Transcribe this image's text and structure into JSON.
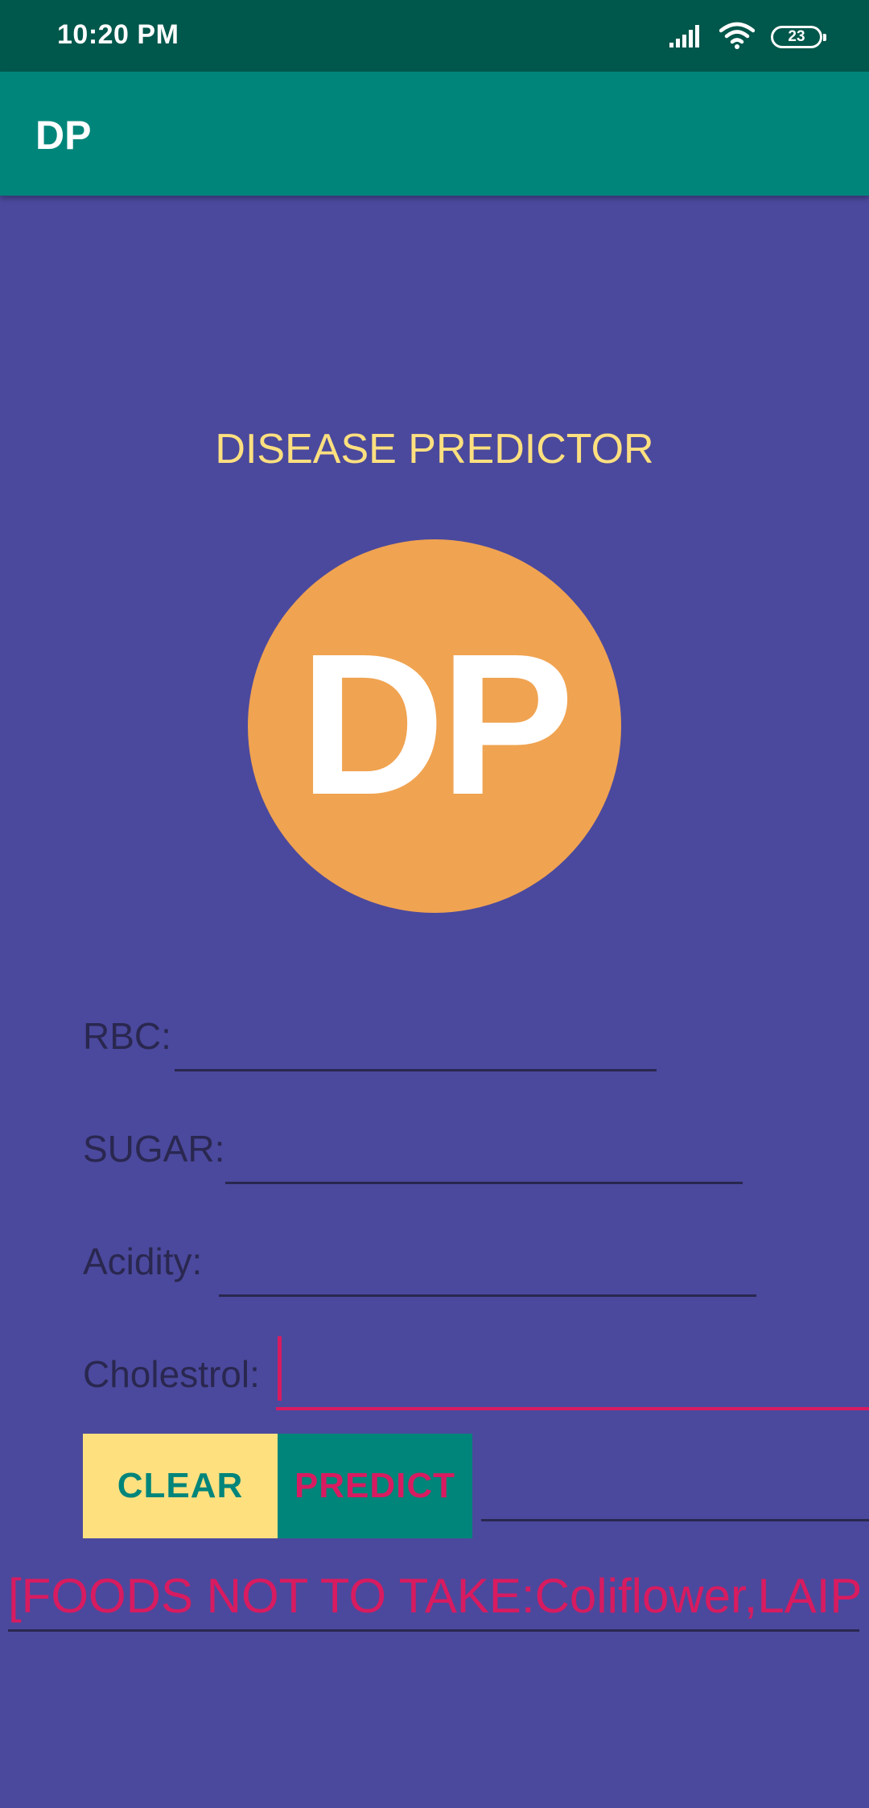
{
  "status_bar": {
    "time": "10:20 PM",
    "battery": "23",
    "icons": [
      "signal-icon",
      "wifi-icon",
      "battery-icon"
    ]
  },
  "app_bar": {
    "title": "DP"
  },
  "main": {
    "heading": "DISEASE PREDICTOR",
    "logo_text": "DP",
    "fields": {
      "rbc": {
        "label": "RBC:",
        "value": ""
      },
      "sugar": {
        "label": "SUGAR:",
        "value": ""
      },
      "acidity": {
        "label": "Acidity:",
        "value": ""
      },
      "cholestrol": {
        "label": "Cholestrol:",
        "value": ""
      }
    },
    "buttons": {
      "clear": "CLEAR",
      "predict": "PREDICT"
    },
    "result_field": {
      "value": ""
    },
    "result_text": "[FOODS NOT TO TAKE:Coliflower,LAIP]"
  },
  "colors": {
    "background": "#4b499d",
    "status_bar": "#00574b",
    "app_bar": "#00857a",
    "heading": "#ffe07f",
    "logo": "#f0a351",
    "accent": "#d81b60"
  }
}
